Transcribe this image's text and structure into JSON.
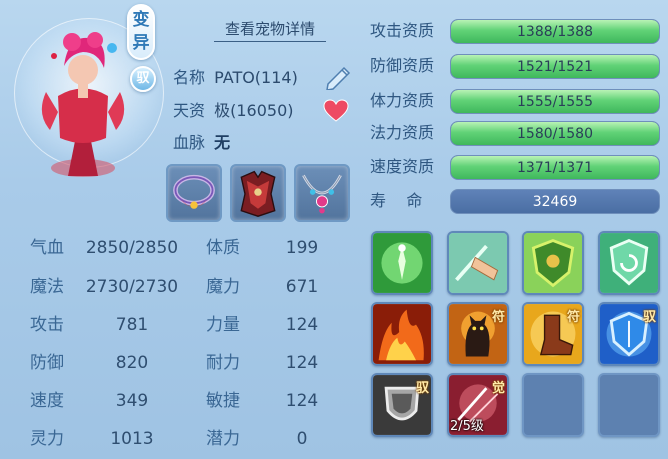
{
  "header": {
    "detail_link": "查看宠物详情",
    "badge_variant": "变异",
    "badge_tame": "驭"
  },
  "pet": {
    "name_label": "名称",
    "name_value": "PATO(114)",
    "talent_label": "天资",
    "talent_value": "极(16050)",
    "blood_label": "血脉",
    "blood_value": "无"
  },
  "equipment": [
    {
      "name": "collar"
    },
    {
      "name": "armor"
    },
    {
      "name": "necklace"
    }
  ],
  "stats": {
    "hp_label": "气血",
    "hp_value": "2850/2850",
    "mp_label": "魔法",
    "mp_value": "2730/2730",
    "atk_label": "攻击",
    "atk_value": "781",
    "def_label": "防御",
    "def_value": "820",
    "spd_label": "速度",
    "spd_value": "349",
    "spi_label": "灵力",
    "spi_value": "1013",
    "con_label": "体质",
    "con_value": "199",
    "mag_label": "魔力",
    "mag_value": "671",
    "str_label": "力量",
    "str_value": "124",
    "end_label": "耐力",
    "end_value": "124",
    "agi_label": "敏捷",
    "agi_value": "124",
    "pot_label": "潜力",
    "pot_value": "0"
  },
  "aptitudes": [
    {
      "label": "攻击资质",
      "value": "1388/1388",
      "fill": 1.0
    },
    {
      "label": "防御资质",
      "value": "1521/1521",
      "fill": 1.0
    },
    {
      "label": "体力资质",
      "value": "1555/1555",
      "fill": 1.0
    },
    {
      "label": "法力资质",
      "value": "1580/1580",
      "fill": 1.0
    },
    {
      "label": "速度资质",
      "value": "1371/1371",
      "fill": 1.0
    }
  ],
  "life": {
    "label": "寿    命",
    "value": "32469"
  },
  "skills": [
    {
      "name": "green-aura",
      "mark": "",
      "tag": ""
    },
    {
      "name": "hand-strike",
      "mark": "",
      "tag": ""
    },
    {
      "name": "shield-emblem",
      "mark": "",
      "tag": ""
    },
    {
      "name": "defense-up",
      "mark": "",
      "tag": ""
    },
    {
      "name": "fire",
      "mark": "",
      "tag": ""
    },
    {
      "name": "black-cat",
      "mark": "符",
      "tag": ""
    },
    {
      "name": "boot",
      "mark": "符",
      "tag": ""
    },
    {
      "name": "blue-shield",
      "mark": "驭",
      "tag": ""
    },
    {
      "name": "gray-shield",
      "mark": "驭",
      "tag": ""
    },
    {
      "name": "awakening",
      "mark": "觉",
      "tag": "2/5级"
    },
    {
      "name": "empty-slot",
      "mark": "",
      "tag": ""
    },
    {
      "name": "empty-slot",
      "mark": "",
      "tag": ""
    }
  ]
}
